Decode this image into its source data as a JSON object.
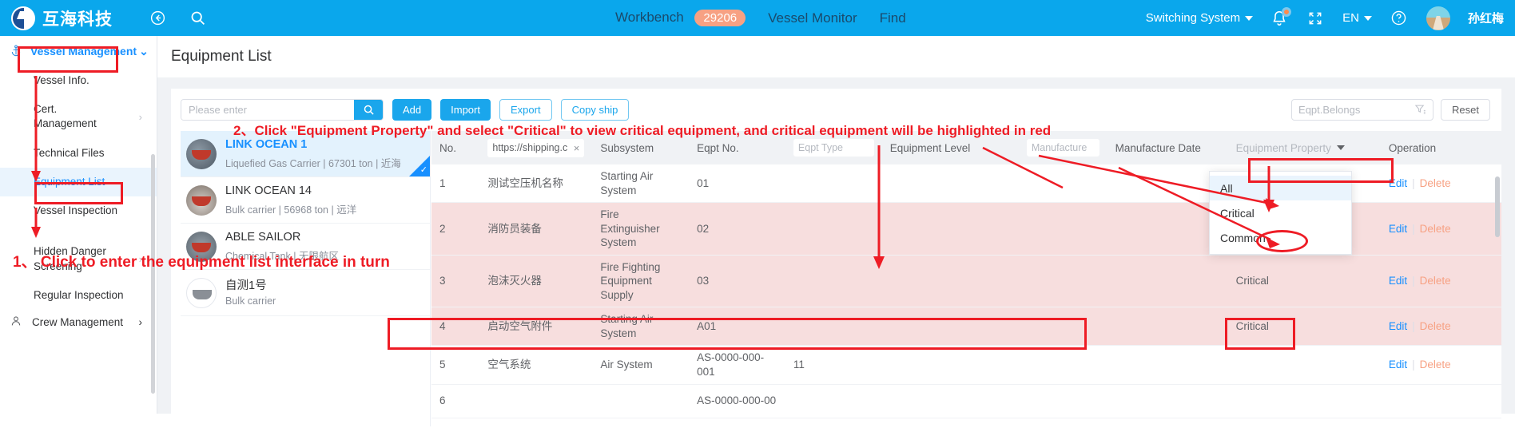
{
  "topbar": {
    "logo_text": "互海科技",
    "back_icon": "back-arrow-icon",
    "search_icon": "search-icon",
    "nav": [
      {
        "label": "Workbench",
        "badge": "29206"
      },
      {
        "label": "Vessel Monitor",
        "badge": ""
      },
      {
        "label": "Find",
        "badge": ""
      }
    ],
    "switching_system": "Switching System",
    "language": "EN",
    "user_name": "孙红梅",
    "bell_icon": "bell-icon",
    "fullscreen_icon": "fullscreen-icon",
    "help_icon": "help-icon"
  },
  "sidebar": {
    "group": {
      "label": "Vessel Management",
      "icon": "anchor-icon"
    },
    "items": [
      {
        "label": "Vessel Info.",
        "chevron": false
      },
      {
        "label": "Cert. Management",
        "chevron": true
      },
      {
        "label": "Technical Files",
        "chevron": false
      },
      {
        "label": "Equipment List",
        "chevron": false,
        "active": true
      },
      {
        "label": "Vessel Inspection",
        "chevron": false
      },
      {
        "label": "Hidden Danger Screening",
        "chevron": true
      },
      {
        "label": "Regular Inspection",
        "chevron": false
      }
    ],
    "bottom_group": {
      "label": "Crew Management",
      "icon": "person-icon",
      "chevron": "›"
    }
  },
  "page": {
    "title": "Equipment List"
  },
  "toolbar": {
    "search_placeholder": "Please enter",
    "search_value": "",
    "search_icon": "search-icon",
    "buttons": [
      {
        "label": "Add",
        "style": "primary"
      },
      {
        "label": "Import",
        "style": "primary"
      },
      {
        "label": "Export",
        "style": "ghost"
      },
      {
        "label": "Copy ship",
        "style": "ghost"
      }
    ],
    "belongs_placeholder": "Eqpt.Belongs",
    "filter_icon": "filter-icon",
    "reset_label": "Reset"
  },
  "vessels": [
    {
      "name": "LINK OCEAN 1",
      "meta": "Liquefied Gas Carrier | 67301 ton | 近海",
      "selected": true,
      "avatar": "vessel-avatar-1"
    },
    {
      "name": "LINK OCEAN 14",
      "meta": "Bulk carrier | 56968 ton | 远洋",
      "selected": false,
      "avatar": "vessel-avatar-2"
    },
    {
      "name": "ABLE SAILOR",
      "meta": "Chemical Tank | 无限航区",
      "selected": false,
      "avatar": "vessel-avatar-3"
    },
    {
      "name": "自测1号",
      "meta": "Bulk carrier",
      "selected": false,
      "avatar": "vessel-avatar-4"
    }
  ],
  "table": {
    "columns": [
      {
        "label": "No.",
        "type": "text"
      },
      {
        "label": "https://shipping.c",
        "type": "input-filled",
        "close": "×"
      },
      {
        "label": "Subsystem",
        "type": "text"
      },
      {
        "label": "Eqpt No.",
        "type": "text"
      },
      {
        "label": "Eqpt Type",
        "type": "input-placeholder"
      },
      {
        "label": "Equipment Level",
        "type": "text"
      },
      {
        "label": "Manufacture",
        "type": "input-placeholder"
      },
      {
        "label": "Manufacture Date",
        "type": "text"
      },
      {
        "label": "Equipment Property",
        "type": "select"
      },
      {
        "label": "Operation",
        "type": "text"
      }
    ],
    "rows": [
      {
        "no": "1",
        "name": "测试空压机名称",
        "subsystem": "Starting Air System",
        "eqpt_no": "01",
        "eqpt_type": "",
        "level": "",
        "manufacture": "",
        "manufacture_date": "",
        "property": "",
        "critical": false,
        "edit": "Edit",
        "delete": "Delete"
      },
      {
        "no": "2",
        "name": "消防员装备",
        "subsystem": "Fire Extinguisher System",
        "eqpt_no": "02",
        "eqpt_type": "",
        "level": "",
        "manufacture": "",
        "manufacture_date": "",
        "property": "",
        "critical": true,
        "edit": "Edit",
        "delete": "Delete"
      },
      {
        "no": "3",
        "name": "泡沫灭火器",
        "subsystem": "Fire Fighting Equipment Supply",
        "eqpt_no": "03",
        "eqpt_type": "",
        "level": "",
        "manufacture": "",
        "manufacture_date": "",
        "property": "Critical",
        "critical": true,
        "edit": "Edit",
        "delete": "Delete"
      },
      {
        "no": "4",
        "name": "启动空气附件",
        "subsystem": "Starting Air System",
        "eqpt_no": "A01",
        "eqpt_type": "",
        "level": "",
        "manufacture": "",
        "manufacture_date": "",
        "property": "Critical",
        "critical": true,
        "edit": "Edit",
        "delete": "Delete"
      },
      {
        "no": "5",
        "name": "空气系统",
        "subsystem": "Air System",
        "eqpt_no": "AS-0000-000-001",
        "eqpt_type": "11",
        "level": "",
        "manufacture": "",
        "manufacture_date": "",
        "property": "",
        "critical": false,
        "edit": "Edit",
        "delete": "Delete"
      },
      {
        "no": "6",
        "name": "",
        "subsystem": "",
        "eqpt_no": "AS-0000-000-00",
        "eqpt_type": "",
        "level": "",
        "manufacture": "",
        "manufacture_date": "",
        "property": "",
        "critical": false,
        "edit": "",
        "delete": ""
      }
    ]
  },
  "dropdown": {
    "options": [
      {
        "label": "All",
        "highlighted": true
      },
      {
        "label": "Critical",
        "highlighted": false
      },
      {
        "label": "Common",
        "highlighted": false
      }
    ]
  },
  "annotations": {
    "step1": "1、 Click to enter the equipment list interface in turn",
    "step2": "2、Click \"Equipment Property\" and select \"Critical\" to view critical equipment, and critical equipment will be highlighted in red",
    "color": "#ee1c25"
  }
}
